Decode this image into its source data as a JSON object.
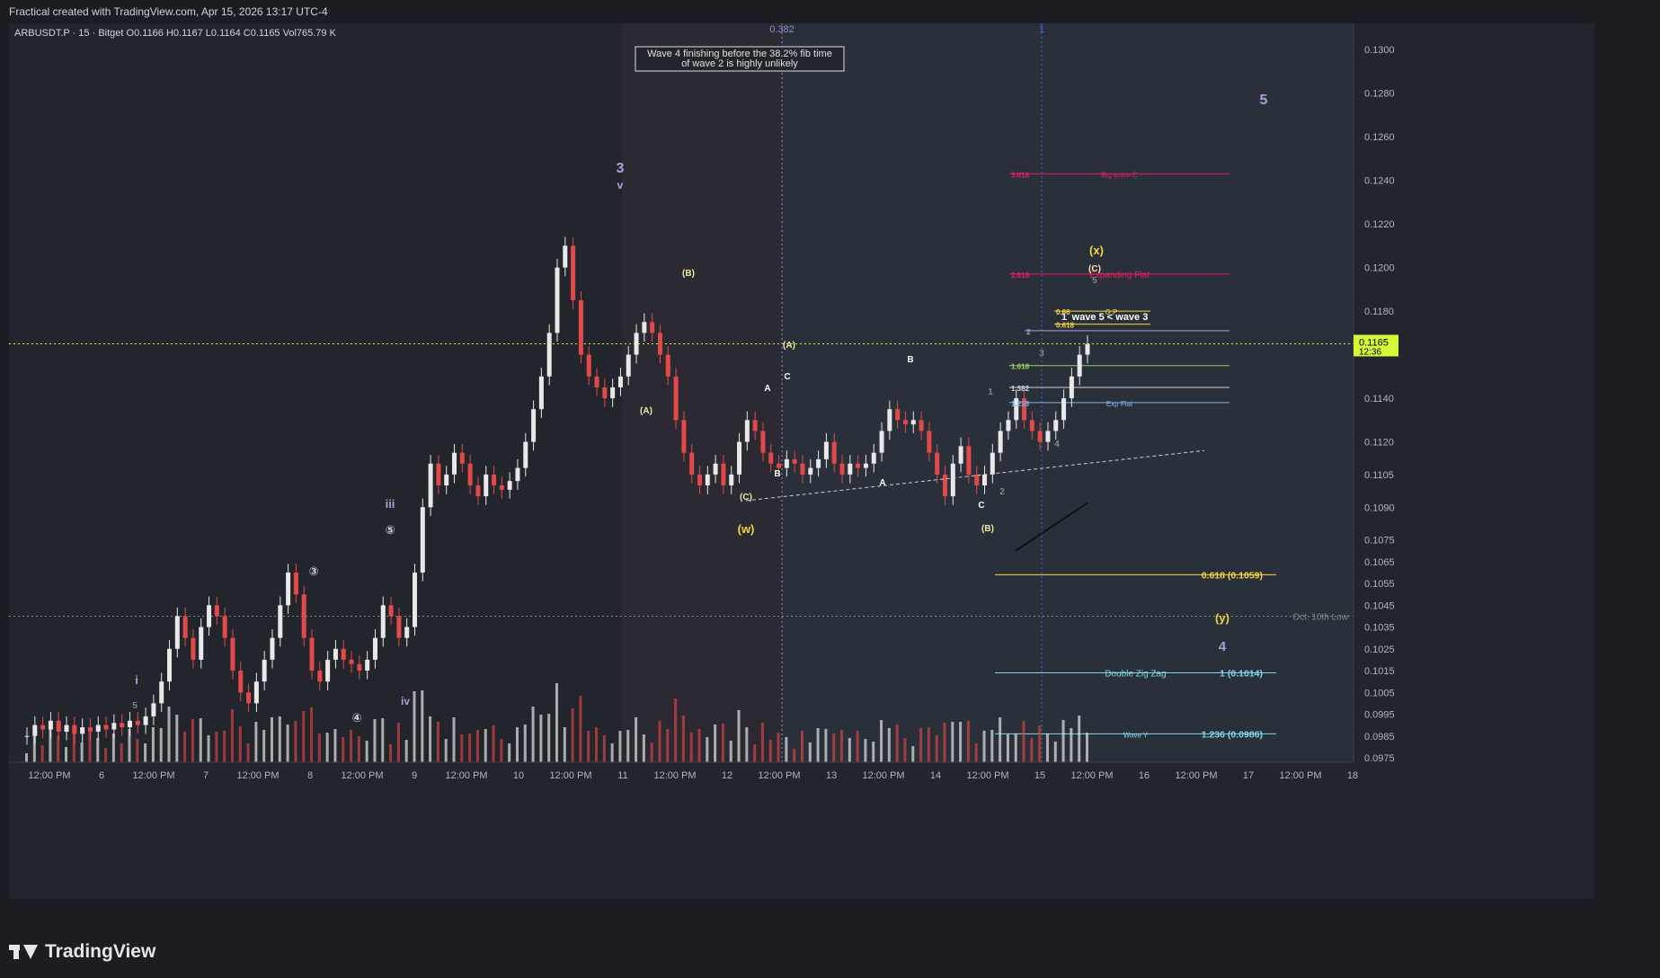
{
  "header": {
    "text": "Fractical created with TradingView.com, Apr 15, 2026 13:17 UTC-4"
  },
  "footer": {
    "brand": "TradingView"
  },
  "colors": {
    "up": "#e8e8e8",
    "down": "#e24a4a",
    "wave_purple": "#b39ddb",
    "fib_yellow": "#f5d742",
    "fib_red": "#e91e63",
    "fib_blue": "#7fb6e8",
    "price_label_bg": "#d4f736"
  },
  "chart_data": {
    "type": "candlestick",
    "symbol_info": {
      "symbol": "ARBUSDT.P · 15 · Bitget",
      "open": "O0.1166",
      "high": "H0.1167",
      "low": "L0.1164",
      "close": "C0.1165",
      "volume": "Vol765.79 K"
    },
    "y_axis": {
      "range": [
        0.0975,
        0.131
      ],
      "ticks": [
        "0.1300",
        "0.1280",
        "0.1260",
        "0.1240",
        "0.1220",
        "0.1200",
        "0.1180",
        "0.1140",
        "0.1120",
        "0.1105",
        "0.1090",
        "0.1075",
        "0.1065",
        "0.1055",
        "0.1045",
        "0.1035",
        "0.1025",
        "0.1015",
        "0.1005",
        "0.0995",
        "0.0985",
        "0.0975"
      ],
      "current_price": "0.1165",
      "countdown": "12:36"
    },
    "x_axis": {
      "ticks": [
        "12:00 PM",
        "6",
        "12:00 PM",
        "7",
        "12:00 PM",
        "8",
        "12:00 PM",
        "9",
        "12:00 PM",
        "10",
        "12:00 PM",
        "11",
        "12:00 PM",
        "12",
        "12:00 PM",
        "13",
        "12:00 PM",
        "14",
        "12:00 PM",
        "15",
        "12:00 PM",
        "16",
        "12:00 PM",
        "17",
        "12:00 PM",
        "18"
      ]
    },
    "price_path": [
      [
        0.0985,
        0.099,
        0.0988,
        0.0992,
        0.0987,
        0.099,
        0.0986,
        0.0989,
        0.0987,
        0.099,
        0.0988,
        0.0991,
        0.0989,
        0.0992,
        0.099,
        0.0994,
        0.1,
        0.101,
        0.1025,
        0.104,
        0.103,
        0.102,
        0.1035,
        0.1045,
        0.104,
        0.103,
        0.1015,
        0.1005,
        0.1,
        0.101,
        0.102,
        0.103,
        0.1045,
        0.106,
        0.105,
        0.103,
        0.1015,
        0.101,
        0.102,
        0.1025,
        0.102,
        0.1018,
        0.1015,
        0.102,
        0.103,
        0.1045,
        0.104,
        0.103,
        0.1035,
        0.106,
        0.109,
        0.111,
        0.11,
        0.1105,
        0.1115,
        0.111,
        0.11,
        0.1095,
        0.1105,
        0.11,
        0.1098,
        0.1102,
        0.1108,
        0.112,
        0.1135,
        0.115,
        0.117,
        0.12,
        0.121,
        0.1185,
        0.116,
        0.115,
        0.1145,
        0.114,
        0.1145,
        0.115,
        0.116,
        0.117,
        0.1175,
        0.117,
        0.116,
        0.115,
        0.113,
        0.1115,
        0.1105,
        0.11,
        0.1105,
        0.111,
        0.11,
        0.1105,
        0.112,
        0.113,
        0.1125,
        0.1115,
        0.111,
        0.1108,
        0.1112,
        0.111,
        0.1105,
        0.1108,
        0.1112,
        0.112,
        0.111,
        0.1105,
        0.111,
        0.1108,
        0.111,
        0.1115,
        0.1125,
        0.1135,
        0.113,
        0.1128,
        0.113,
        0.1125,
        0.1115,
        0.1105,
        0.1095,
        0.111,
        0.1118,
        0.1105,
        0.11,
        0.1105,
        0.1115,
        0.1125,
        0.113,
        0.114,
        0.113,
        0.1125,
        0.112,
        0.1125,
        0.113,
        0.114,
        0.115,
        0.116,
        0.1165
      ]
    ],
    "volume_note": "volume bars along bottom",
    "vertical_markers": [
      {
        "label": "0.382",
        "color": "#8f8fcf"
      },
      {
        "label": "1",
        "color": "#3d6fd6"
      }
    ],
    "horizontal_levels": [
      {
        "price": 0.1243,
        "label": "3.618",
        "name": "Big wave C",
        "color": "#e91e63"
      },
      {
        "price": 0.1197,
        "label": "2.618",
        "name": "Expanding Flat",
        "color": "#e91e63"
      },
      {
        "price": 0.118,
        "label": "0.66",
        "name": "G P",
        "color": "#f5d742"
      },
      {
        "price": 0.1174,
        "label": "0.618",
        "name": "",
        "color": "#f5d742"
      },
      {
        "price": 0.1171,
        "label": "2",
        "name": "",
        "color": "#b39ddb"
      },
      {
        "price": 0.1155,
        "label": "1.618",
        "name": "",
        "color": "#9ccc65"
      },
      {
        "price": 0.1145,
        "label": "1.382",
        "name": "",
        "color": "#d1d4dc"
      },
      {
        "price": 0.1138,
        "label": "1.236",
        "name": "Exp Flat",
        "color": "#7fb6e8"
      },
      {
        "price": 0.1059,
        "label": "0.618 (0.1059)",
        "name": "",
        "color": "#f5d742"
      },
      {
        "price": 0.104,
        "label": "",
        "name": "Oct. 10th Low",
        "color": "#888888"
      },
      {
        "price": 0.1014,
        "label": "1 (0.1014)",
        "name": "Double Zig Zag",
        "color": "#7fd6e8"
      },
      {
        "price": 0.0986,
        "label": "1.236 (0.0986)",
        "name": "Wave Y",
        "color": "#7fd6e8"
      }
    ],
    "annotations": {
      "note_box": [
        "Wave 4 finishing before the 38.2% fib time",
        "of wave 2 is highly unlikely"
      ],
      "wave_labels": [
        {
          "text": "3",
          "color": "#b39ddb"
        },
        {
          "text": "v",
          "color": "#b39ddb"
        },
        {
          "text": "iii",
          "color": "#b39ddb"
        },
        {
          "text": "iv",
          "color": "#b39ddb"
        },
        {
          "text": "i",
          "color": "#b39ddb"
        },
        {
          "text": "5",
          "color": "#888"
        },
        {
          "text": "③",
          "color": "#d1d4dc"
        },
        {
          "text": "④",
          "color": "#d1d4dc"
        },
        {
          "text": "⑤",
          "color": "#d1d4dc"
        },
        {
          "text": "(A)",
          "color": "#f5e6a8"
        },
        {
          "text": "(B)",
          "color": "#f5e6a8"
        },
        {
          "text": "(C)",
          "color": "#f5e6a8"
        },
        {
          "text": "(w)",
          "color": "#f5d742"
        },
        {
          "text": "(A)",
          "color": "#f5e6a8"
        },
        {
          "text": "A",
          "color": "#ffffff"
        },
        {
          "text": "B",
          "color": "#ffffff"
        },
        {
          "text": "C",
          "color": "#ffffff"
        },
        {
          "text": "A",
          "color": "#ffffff"
        },
        {
          "text": "B",
          "color": "#ffffff"
        },
        {
          "text": "C",
          "color": "#ffffff"
        },
        {
          "text": "(B)",
          "color": "#f5e6a8"
        },
        {
          "text": "1",
          "color": "#888"
        },
        {
          "text": "2",
          "color": "#888"
        },
        {
          "text": "3",
          "color": "#888"
        },
        {
          "text": "4",
          "color": "#888"
        },
        {
          "text": "5",
          "color": "#888"
        },
        {
          "text": "(C)",
          "color": "#f5e6a8"
        },
        {
          "text": "(x)",
          "color": "#f5d742"
        },
        {
          "text": "(y)",
          "color": "#f5d742"
        },
        {
          "text": "4",
          "color": "#b39ddb"
        },
        {
          "text": "5",
          "color": "#b39ddb"
        },
        {
          "text": "1",
          "color": "#ffffff"
        },
        {
          "text": "wave 5 < wave 3",
          "color": "#ffffff"
        }
      ]
    }
  }
}
